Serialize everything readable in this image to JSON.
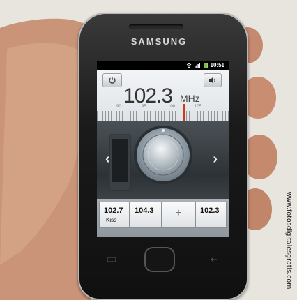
{
  "phone": {
    "brand": "SAMSUNG"
  },
  "status_bar": {
    "time": "10:51",
    "icons": [
      "wifi-icon",
      "signal-icon",
      "battery-icon"
    ]
  },
  "radio": {
    "frequency": "102.3",
    "unit": "MHz",
    "scale_labels": [
      "90",
      "95",
      "100",
      "105"
    ],
    "power_icon": "power-icon",
    "volume_icon": "speaker-icon",
    "prev_icon": "chevron-left-icon",
    "next_icon": "chevron-right-icon",
    "presets": [
      {
        "frequency": "102.7",
        "name": "Kiss"
      },
      {
        "frequency": "104.3",
        "name": ""
      },
      {
        "label": "+"
      },
      {
        "frequency": "102.3",
        "name": ""
      }
    ]
  },
  "watermark": "www.fotosdigitalesgratis.com",
  "colors": {
    "needle": "#d03a1a",
    "screen_bg": "#d8dde2",
    "dial_area": "#2d3236"
  }
}
